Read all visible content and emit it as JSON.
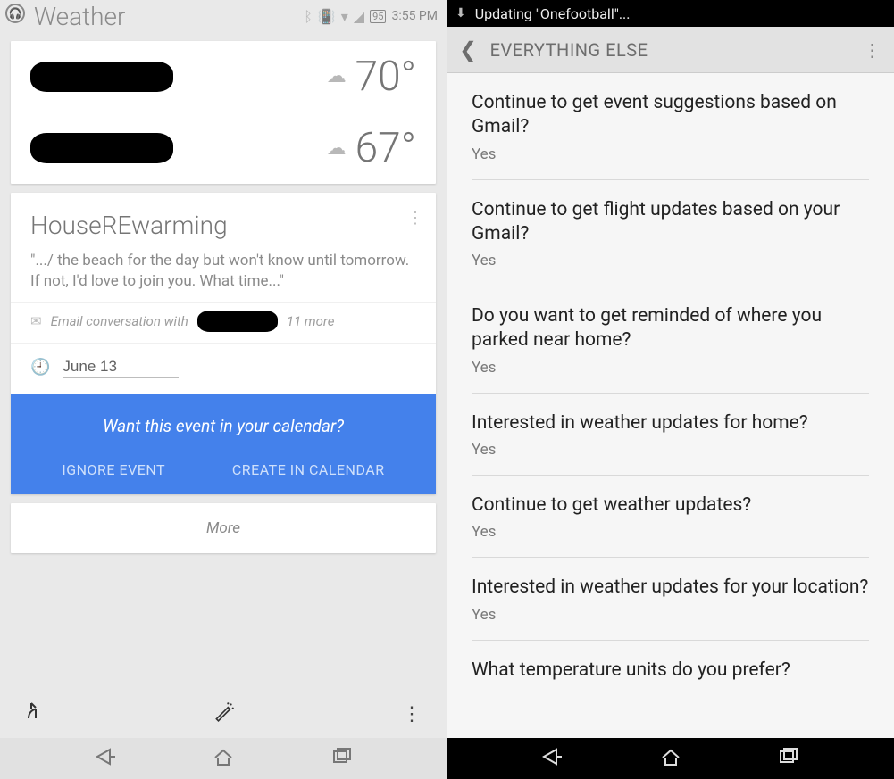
{
  "left": {
    "status": {
      "title": "Weather",
      "battery": "95",
      "time": "3:55 PM"
    },
    "weather": {
      "row1": {
        "temp": "70°"
      },
      "row2": {
        "temp": "67°"
      }
    },
    "event": {
      "title": "HouseREwarming",
      "body": "\".../ the beach for the day but won't know until tomorrow. If not, I'd love to join you. What time...\"",
      "meta_prefix": "Email conversation with",
      "meta_suffix": "11 more",
      "date": "June 13",
      "prompt": "Want this event in your calendar?",
      "ignore": "IGNORE EVENT",
      "create": "CREATE IN CALENDAR"
    },
    "more": "More"
  },
  "right": {
    "status": {
      "text": "Updating \"Onefootball\"..."
    },
    "header": {
      "title": "EVERYTHING ELSE"
    },
    "items": [
      {
        "q": "Continue to get event suggestions based on Gmail?",
        "a": "Yes"
      },
      {
        "q": "Continue to get flight updates based on your Gmail?",
        "a": "Yes"
      },
      {
        "q": "Do you want to get reminded of where you parked near home?",
        "a": "Yes"
      },
      {
        "q": "Interested in weather updates for home?",
        "a": "Yes"
      },
      {
        "q": "Continue to get weather updates?",
        "a": "Yes"
      },
      {
        "q": "Interested in weather updates for your location?",
        "a": "Yes"
      },
      {
        "q": "What temperature units do you prefer?",
        "a": ""
      }
    ]
  }
}
